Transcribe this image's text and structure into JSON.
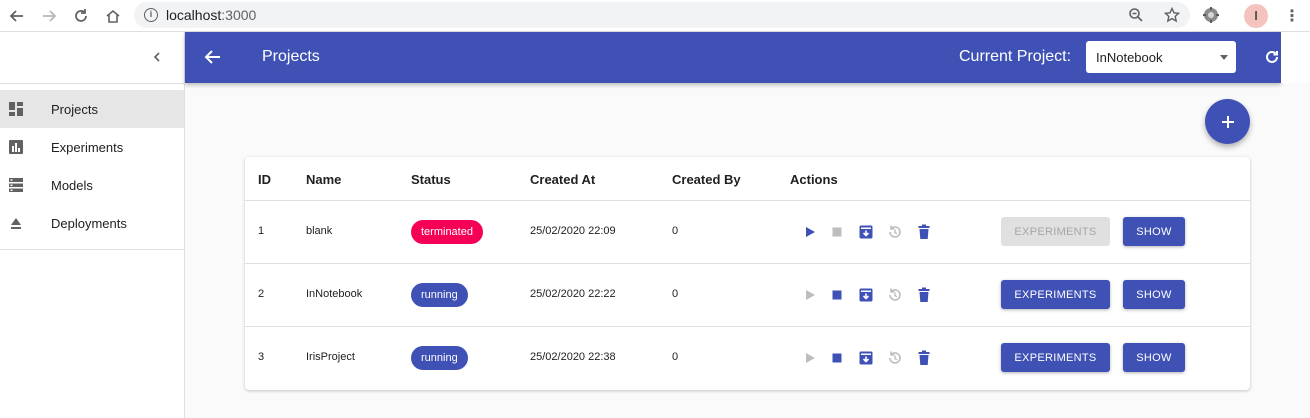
{
  "browser": {
    "url_host": "localhost",
    "url_port": ":3000",
    "icons": [
      "back-arrow-icon",
      "forward-arrow-icon",
      "reload-icon",
      "home-icon",
      "info-icon",
      "zoom-icon",
      "star-icon",
      "extension-icon",
      "profile-avatar",
      "menu-kebab-icon"
    ],
    "avatar_letter": "l"
  },
  "sidebar": {
    "items": [
      {
        "label": "Projects",
        "icon": "dashboard-icon",
        "active": true
      },
      {
        "label": "Experiments",
        "icon": "bar-chart-icon",
        "active": false
      },
      {
        "label": "Models",
        "icon": "storage-icon",
        "active": false
      },
      {
        "label": "Deployments",
        "icon": "eject-icon",
        "active": false
      }
    ]
  },
  "appbar": {
    "title": "Projects",
    "current_project_label": "Current Project:",
    "current_project_value": "InNotebook",
    "color": "#3f51b5"
  },
  "table": {
    "headers": [
      "ID",
      "Name",
      "Status",
      "Created At",
      "Created By",
      "Actions"
    ],
    "rows": [
      {
        "id": "1",
        "name": "blank",
        "status": "terminated",
        "created_at": "25/02/2020 22:09",
        "created_by": "0",
        "experiments_label": "EXPERIMENTS",
        "experiments_enabled": false,
        "show_label": "SHOW"
      },
      {
        "id": "2",
        "name": "InNotebook",
        "status": "running",
        "created_at": "25/02/2020 22:22",
        "created_by": "0",
        "experiments_label": "EXPERIMENTS",
        "experiments_enabled": true,
        "show_label": "SHOW"
      },
      {
        "id": "3",
        "name": "IrisProject",
        "status": "running",
        "created_at": "25/02/2020 22:38",
        "created_by": "0",
        "experiments_label": "EXPERIMENTS",
        "experiments_enabled": true,
        "show_label": "SHOW"
      }
    ]
  },
  "colors": {
    "primary": "#3f51b5",
    "terminated": "#f50057",
    "disabled_icon": "#bdbdbd"
  }
}
